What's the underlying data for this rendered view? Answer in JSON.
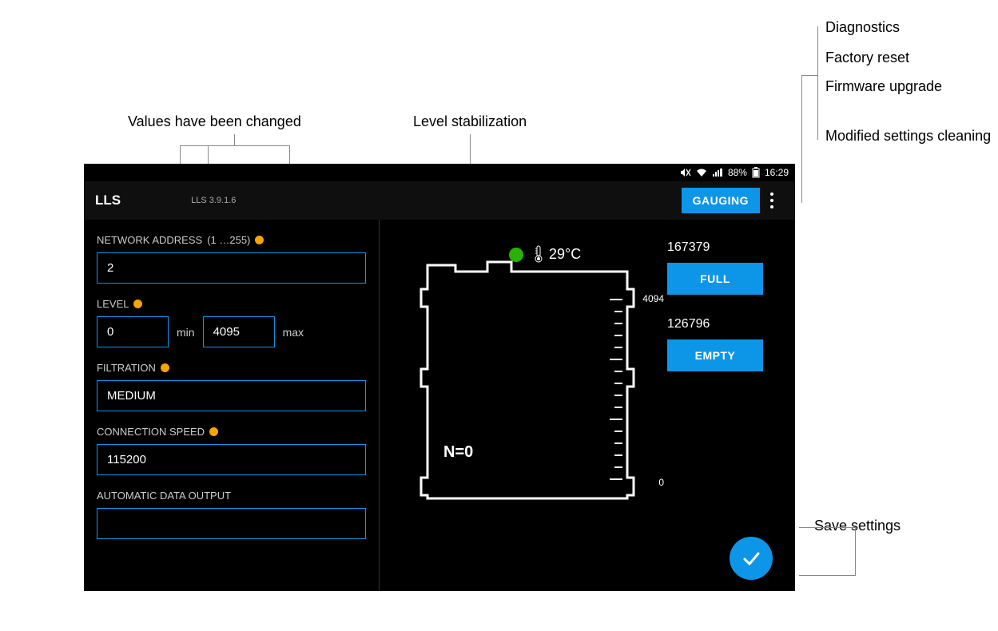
{
  "callouts": {
    "values_changed": "Values have been changed",
    "level_stabilization": "Level stabilization",
    "save_settings": "Save settings",
    "menu": {
      "diagnostics": "Diagnostics",
      "factory_reset": "Factory reset",
      "firmware_upgrade": "Firmware upgrade",
      "modified_cleaning": "Modified settings cleaning"
    }
  },
  "statusbar": {
    "battery": "88%",
    "time": "16:29"
  },
  "titlebar": {
    "title": "LLS",
    "version": "LLS 3.9.1.6",
    "gauging": "GAUGING"
  },
  "form": {
    "network_address": {
      "label": "NETWORK ADDRESS",
      "range": "(1 …255)",
      "value": "2"
    },
    "level": {
      "label": "LEVEL",
      "min_value": "0",
      "min_label": "min",
      "max_value": "4095",
      "max_label": "max"
    },
    "filtration": {
      "label": "FILTRATION",
      "value": "MEDIUM"
    },
    "connection_speed": {
      "label": "CONNECTION SPEED",
      "value": "115200"
    },
    "auto_output": {
      "label": "AUTOMATIC DATA OUTPUT"
    }
  },
  "tank": {
    "temperature": "29°С",
    "scale_max": "4094",
    "scale_min": "0",
    "n_value": "N=0"
  },
  "calibration": {
    "full_value": "167379",
    "full_label": "FULL",
    "empty_value": "126796",
    "empty_label": "EMPTY"
  }
}
